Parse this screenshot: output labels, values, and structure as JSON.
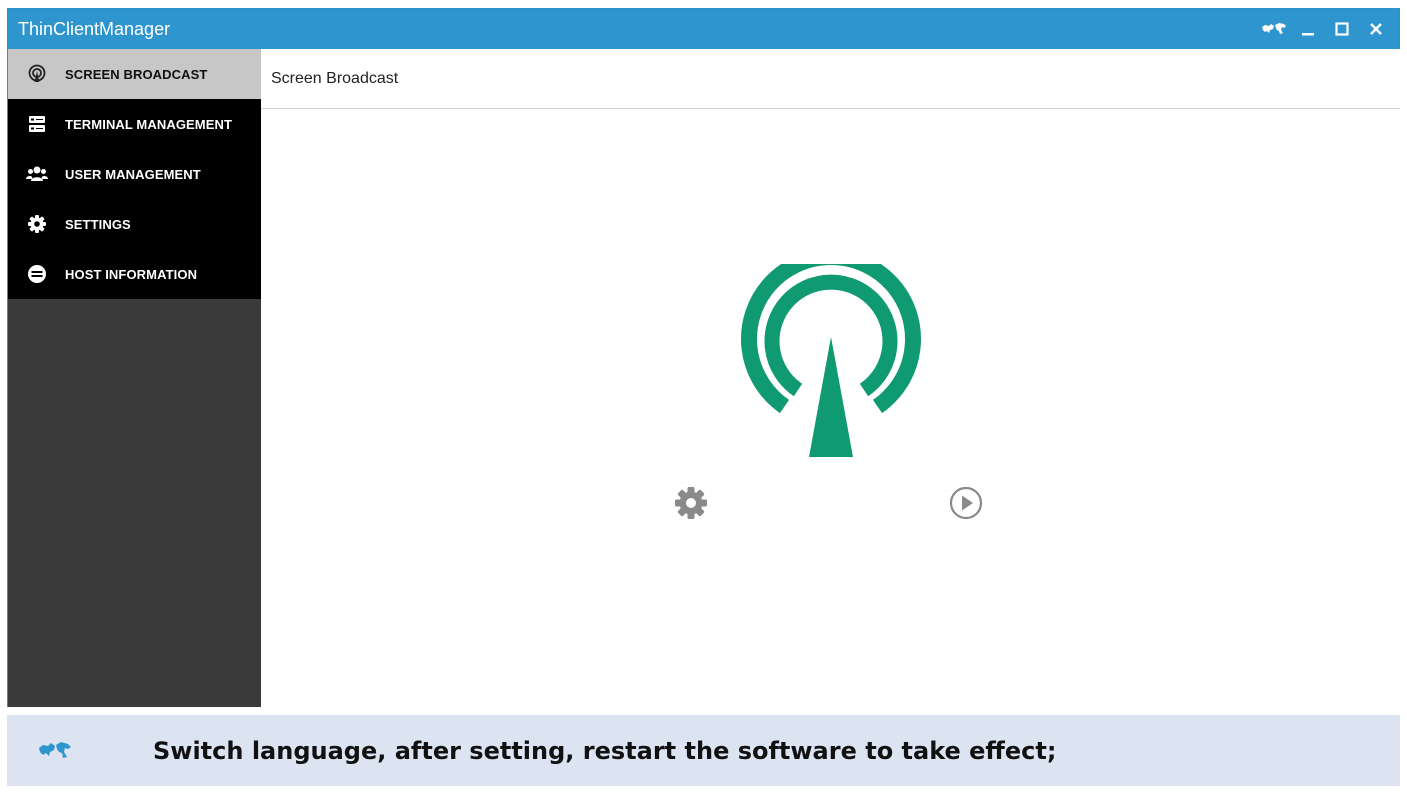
{
  "window": {
    "title": "ThinClientManager",
    "controls": [
      "language-icon",
      "minimize-icon",
      "maximize-icon",
      "close-icon"
    ]
  },
  "sidebar": {
    "items": [
      {
        "label": "SCREEN BROADCAST",
        "icon": "broadcast-icon",
        "active": true
      },
      {
        "label": "TERMINAL MANAGEMENT",
        "icon": "server-icon",
        "active": false
      },
      {
        "label": "USER MANAGEMENT",
        "icon": "users-icon",
        "active": false
      },
      {
        "label": "SETTINGS",
        "icon": "gear-icon",
        "active": false
      },
      {
        "label": "HOST INFORMATION",
        "icon": "host-info-icon",
        "active": false
      }
    ]
  },
  "main": {
    "header": "Screen Broadcast",
    "broadcast_icon": "broadcast-antenna-icon",
    "settings_icon": "gear-icon",
    "start_icon": "play-circle-icon"
  },
  "banner": {
    "icon": "world-map-icon",
    "text": "Switch language, after setting, restart the software to take effect;"
  },
  "colors": {
    "titlebar": "#2f95cf",
    "sidebar_active": "#c7c7c7",
    "sidebar_menu": "#000000",
    "sidebar_bg": "#3a3a3a",
    "broadcast_green": "#0f9a72",
    "banner_bg": "#dce4f2"
  }
}
